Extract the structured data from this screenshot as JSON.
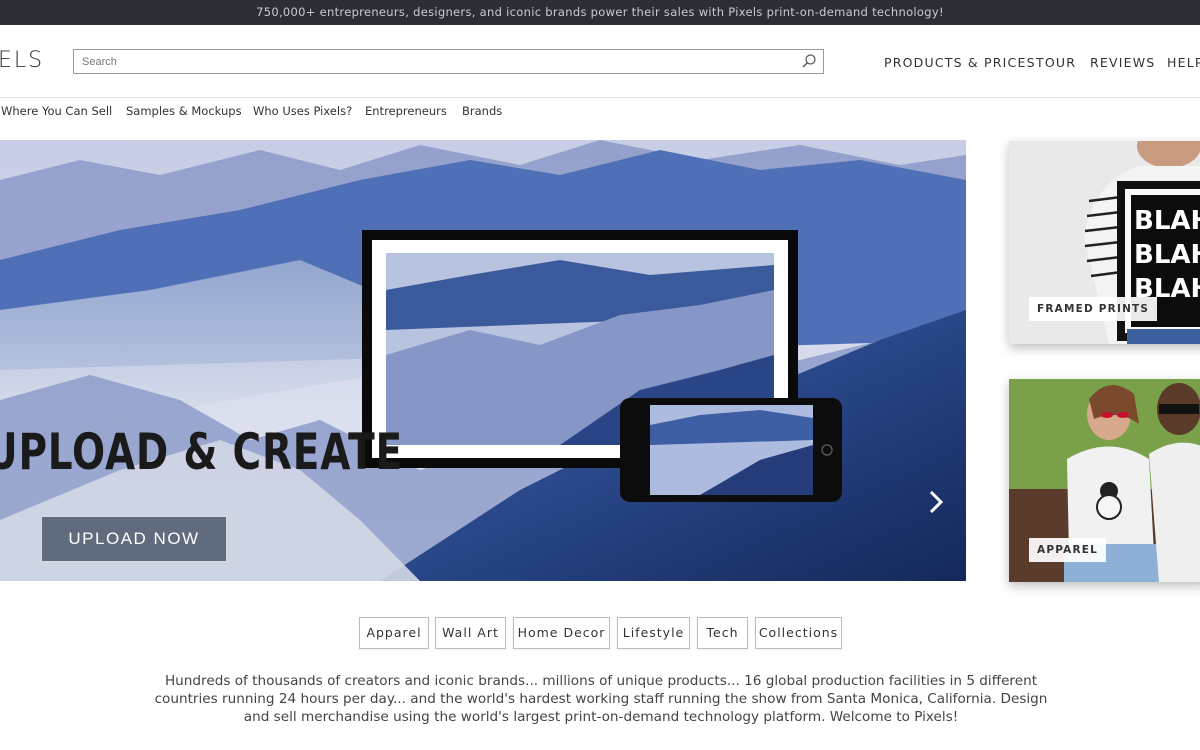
{
  "promo": {
    "text": "750,000+ entrepreneurs, designers, and iconic brands power their sales with Pixels print-on-demand technology!"
  },
  "header": {
    "logo_text": "ELS",
    "search_placeholder": "Search",
    "nav": [
      "PRODUCTS & PRICES",
      "TOUR",
      "REVIEWS",
      "HELP"
    ]
  },
  "subnav": [
    "Where You Can Sell",
    "Samples & Mockups",
    "Who Uses Pixels?",
    "Entrepreneurs",
    "Brands"
  ],
  "hero": {
    "title": "UPLOAD & CREATE",
    "cta": "UPLOAD NOW"
  },
  "side_cards": [
    {
      "label": "FRAMED PRINTS",
      "art_text": "BLAH"
    },
    {
      "label": "APPAREL"
    }
  ],
  "categories": [
    "Apparel",
    "Wall Art",
    "Home Decor",
    "Lifestyle",
    "Tech",
    "Collections"
  ],
  "description": "Hundreds of thousands of creators and iconic brands... millions of unique products... 16 global production facilities in 5 different countries running 24 hours per day... and the world's hardest working staff running the show from Santa Monica, California.   Design and sell merchandise using the world's largest print-on-demand technology platform.   Welcome to Pixels!",
  "colors": {
    "topbar": "#2b2f35",
    "hero_sky": "#b9c4dc",
    "hero_mountain": "#2d4f9a"
  }
}
